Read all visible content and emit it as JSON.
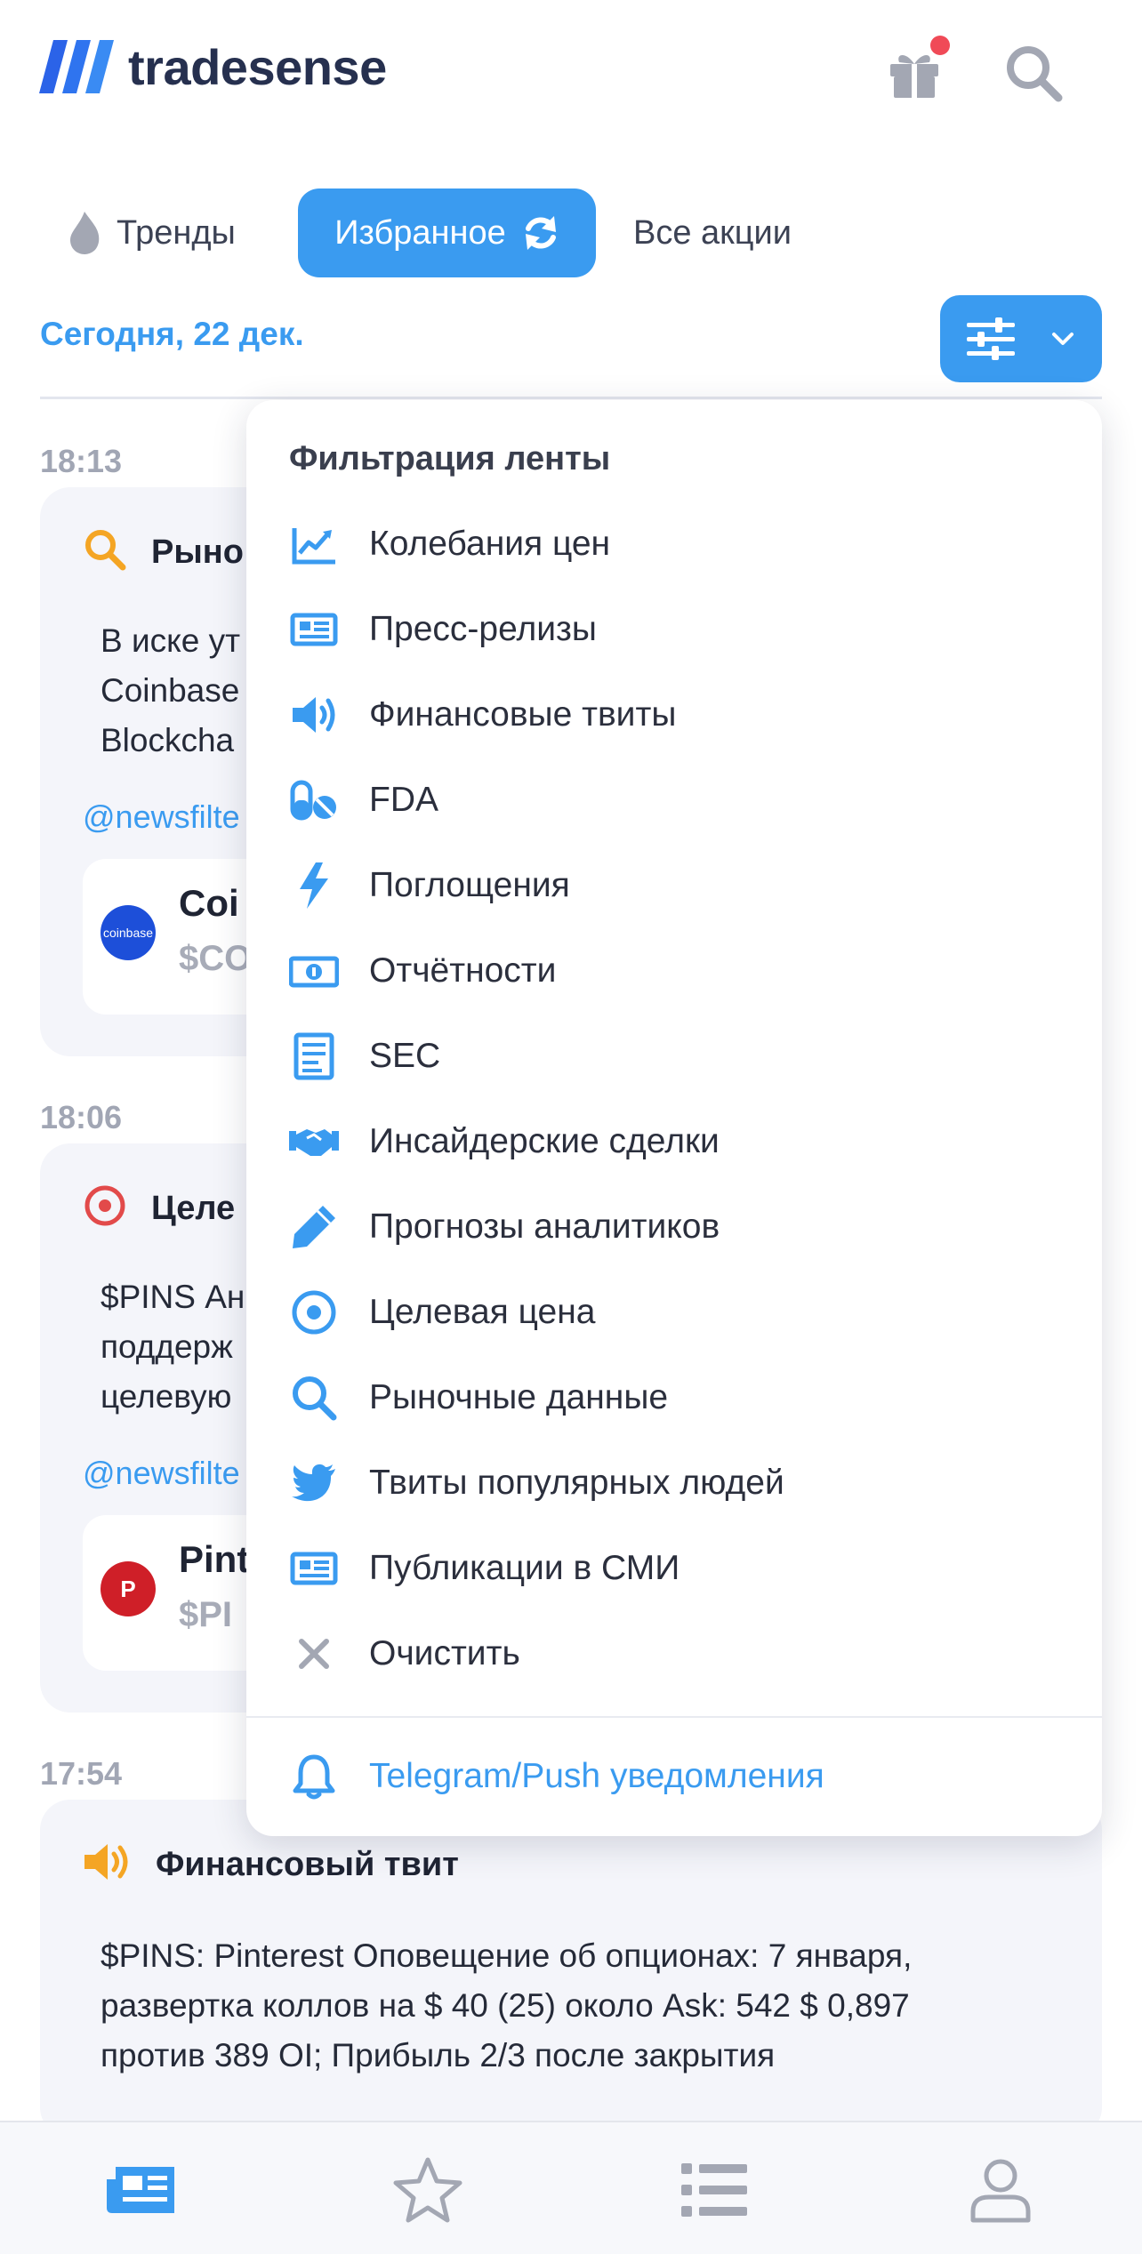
{
  "app": {
    "brand": "tradesense"
  },
  "tabs": [
    {
      "label": "Тренды"
    },
    {
      "label": "Избранное"
    },
    {
      "label": "Все акции"
    }
  ],
  "date": "Сегодня, 22 дек.",
  "colors": {
    "accent": "#3a9bf0",
    "notification": "#f04a57",
    "text": "#1f2433"
  },
  "feed": [
    {
      "time": "18:13",
      "icon": "magnifier-icon",
      "title": "Рыно",
      "text": [
        "В иске ут",
        "Coinbase",
        "Blockcha"
      ],
      "tag": "@newsfilte",
      "stock": {
        "name": "Coi",
        "ticker": "$CO",
        "logo_text": "coinbase"
      }
    },
    {
      "time": "18:06",
      "icon": "target-icon",
      "title": "Целе",
      "text": [
        "$PINS Ан",
        "поддерж",
        "целевую"
      ],
      "tag": "@newsfilte",
      "stock": {
        "name": "Pint",
        "ticker": "$PI",
        "logo_text": "P"
      }
    },
    {
      "time": "17:54",
      "icon": "megaphone-icon",
      "title": "Финансовый твит",
      "text": [
        "$PINS: Pinterest Оповещение об опционах: 7 января,",
        "развертка коллов на $ 40 (25) около Ask: 542 $ 0,897",
        "против 389 OI; Прибыль 2/3 после закрытия"
      ]
    }
  ],
  "filter_menu": {
    "title": "Фильтрация ленты",
    "items": [
      {
        "label": "Колебания цен",
        "icon": "chart-line-icon"
      },
      {
        "label": "Пресс-релизы",
        "icon": "newspaper-icon"
      },
      {
        "label": "Финансовые твиты",
        "icon": "megaphone-icon"
      },
      {
        "label": "FDA",
        "icon": "pills-icon"
      },
      {
        "label": "Поглощения",
        "icon": "lightning-icon"
      },
      {
        "label": "Отчётности",
        "icon": "money-bill-icon"
      },
      {
        "label": "SEC",
        "icon": "document-icon"
      },
      {
        "label": "Инсайдерские сделки",
        "icon": "handshake-icon"
      },
      {
        "label": "Прогнозы аналитиков",
        "icon": "pencil-icon"
      },
      {
        "label": "Целевая цена",
        "icon": "target-icon"
      },
      {
        "label": "Рыночные данные",
        "icon": "magnifier-icon"
      },
      {
        "label": "Твиты популярных людей",
        "icon": "twitter-icon"
      },
      {
        "label": "Публикации в СМИ",
        "icon": "newspaper-icon"
      },
      {
        "label": "Очистить",
        "icon": "close-icon"
      }
    ],
    "notifications_label": "Telegram/Push уведомления"
  },
  "bottom_nav": [
    {
      "icon": "news-icon"
    },
    {
      "icon": "star-icon"
    },
    {
      "icon": "list-icon"
    },
    {
      "icon": "profile-icon"
    }
  ]
}
